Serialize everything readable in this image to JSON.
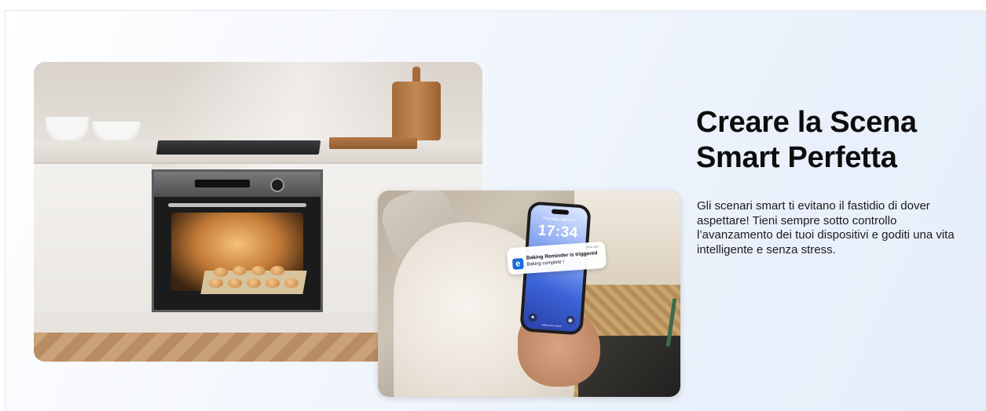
{
  "hero": {
    "headline": "Creare la Scena Smart Perfetta",
    "description": "Gli scenari smart ti evitano il fastidio di dover aspettare! Tieni sempre sotto controllo l’avanzamento dei tuoi dispositivi e goditi una vita intelligente e senza stress."
  },
  "phone": {
    "date": "Thursday, March 4",
    "time": "17:34",
    "swipe_hint": "Swipe up to unlock",
    "notification": {
      "app_icon": "e",
      "meta": "Now ago",
      "title": "Baking Reminder is triggered",
      "body": "Baking complete !"
    }
  },
  "colors": {
    "headline": "#0d0d0d",
    "background_tint": "#e8f0fb",
    "app_icon": "#1a6cd8"
  }
}
